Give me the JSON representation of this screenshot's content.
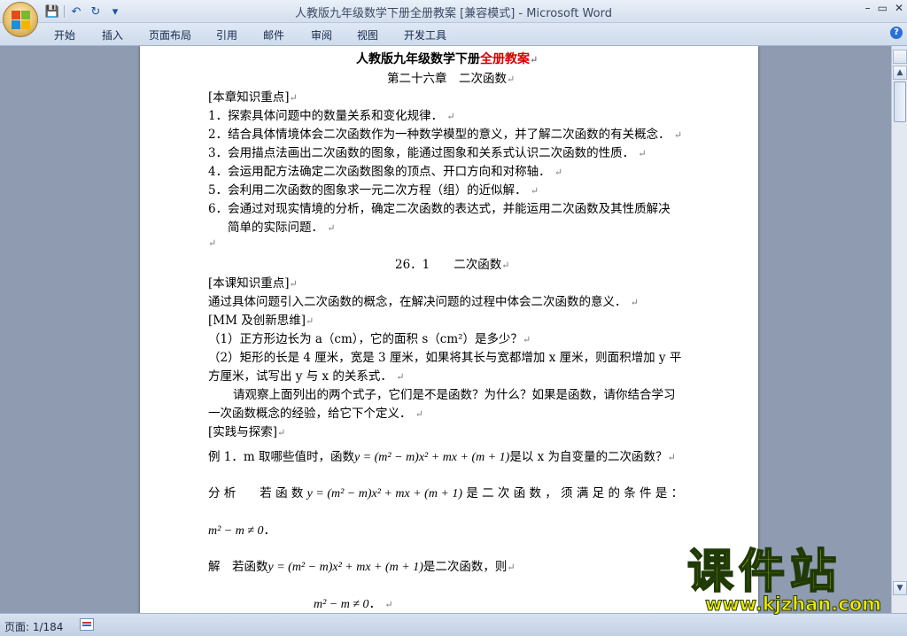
{
  "window": {
    "title_doc": "人教版九年级数学下册全册教案 [兼容模式]",
    "title_sep": " - ",
    "title_app": "Microsoft Word",
    "controls": [
      "–",
      "▭",
      "✕"
    ]
  },
  "qat": {
    "save": "💾",
    "undo": "↶",
    "redo": "↻",
    "more": "▾"
  },
  "ribbon": {
    "tabs": [
      "开始",
      "插入",
      "页面布局",
      "引用",
      "邮件",
      "审阅",
      "视图",
      "开发工具"
    ],
    "help": "?"
  },
  "document": {
    "title_black": "人教版九年级数学下册",
    "title_red": "全册教案",
    "chapter": "第二十六章　二次函数",
    "section_key": "[本章知识重点]",
    "goals": [
      "1．探索具体问题中的数量关系和变化规律．",
      "2．结合具体情境体会二次函数作为一种数学模型的意义，并了解二次函数的有关概念．",
      "3．会用描点法画出二次函数的图象，能通过图象和关系式认识二次函数的性质．",
      "4．会运用配方法确定二次函数图象的顶点、开口方向和对称轴．",
      "5．会利用二次函数的图象求一元二次方程（组）的近似解．",
      "6．会通过对现实情境的分析，确定二次函数的表达式，并能运用二次函数及其性质解决",
      "简单的实际问题．"
    ],
    "sub_heading": "26．1　　二次函数",
    "lesson_key": "[本课知识重点]",
    "lesson_text": "通过具体问题引入二次函数的概念，在解决问题的过程中体会二次函数的意义．",
    "mm_heading": "[MM 及创新思维]",
    "q1": "（1）正方形边长为 a（cm），它的面积 s（cm²）是多少？",
    "q2a": "（2）矩形的长是 4 厘米，宽是 3 厘米，如果将其长与宽都增加 x 厘米，则面积增加 y 平",
    "q2b": "方厘米，试写出 y 与 x 的关系式．",
    "obs1": "请观察上面列出的两个式子，它们是不是函数？为什么？如果是函数，请你结合学习",
    "obs2": "一次函数概念的经验，给它下个定义．",
    "practice": "[实践与探索]",
    "ex1_pre": "例 1．m 取哪些值时，函数",
    "ex1_formula": "y = (m² − m)x² + mx + (m + 1)",
    "ex1_post": "是以 x 为自变量的二次函数？",
    "analysis_pre": "分 析　　若 函 数",
    "analysis_formula": "y = (m² − m)x² + mx + (m + 1)",
    "analysis_post": "是 二 次 函 数 ， 须 满 足 的 条 件 是 ：",
    "cond1": "m² − m ≠ 0",
    "cond1_tail": "．",
    "sol_pre": "解　若函数",
    "sol_formula": "y = (m² − m)x² + mx + (m + 1)",
    "sol_post": "是二次函数，则",
    "cond2": "m² − m ≠ 0",
    "cond2_tail": "．",
    "para_mark": "↵"
  },
  "status": {
    "pages": "页面: 1/184"
  },
  "scrollbar": {
    "up": "▲",
    "down": "▼"
  },
  "watermark": {
    "big": "课件站",
    "small": "www.kjzhan.com"
  }
}
